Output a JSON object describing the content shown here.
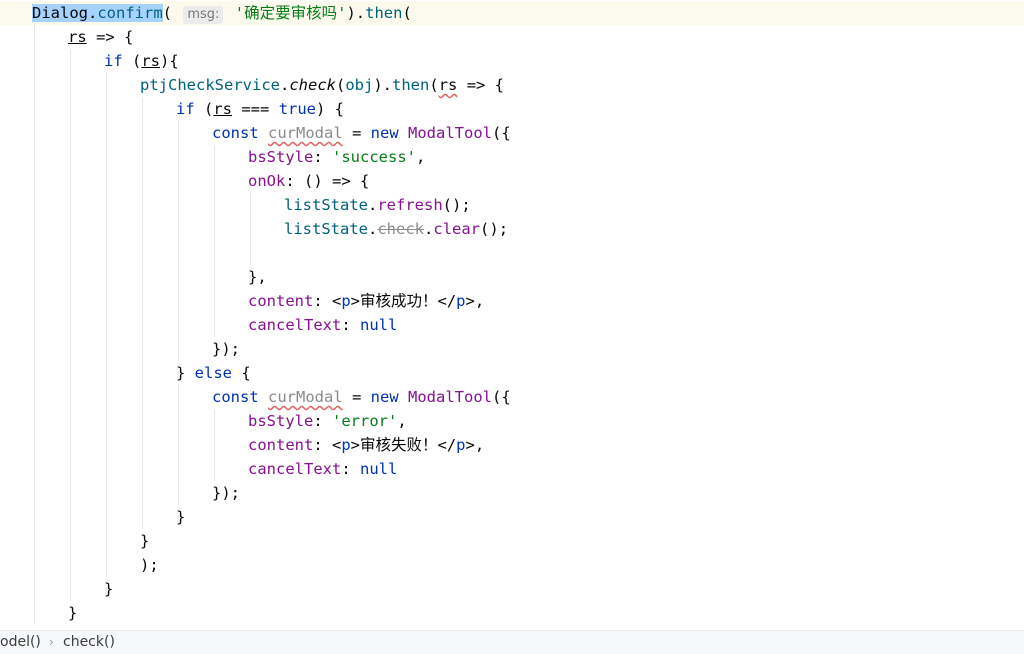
{
  "editor": {
    "lines": [
      {
        "indent": 0,
        "current": true,
        "tokens": [
          {
            "t": "Dialog",
            "c": "sel"
          },
          {
            "t": ".",
            "c": "sel"
          },
          {
            "t": "confirm",
            "c": "sel t-method"
          },
          {
            "t": "( "
          },
          {
            "t": "msg:",
            "c": "hint"
          },
          {
            "t": " "
          },
          {
            "t": "'确定要审核吗'",
            "c": "t-str"
          },
          {
            "t": ")."
          },
          {
            "t": "then",
            "c": "t-then"
          },
          {
            "t": "("
          }
        ]
      },
      {
        "indent": 1,
        "tokens": [
          {
            "t": "rs",
            "c": "t-param"
          },
          {
            "t": " => {"
          }
        ]
      },
      {
        "indent": 2,
        "tokens": [
          {
            "t": "if",
            "c": "t-kw"
          },
          {
            "t": " ("
          },
          {
            "t": "rs",
            "c": "t-param"
          },
          {
            "t": "){"
          }
        ]
      },
      {
        "indent": 3,
        "tokens": [
          {
            "t": "ptjCheckService",
            "c": "t-var"
          },
          {
            "t": "."
          },
          {
            "t": "check",
            "c": "t-check"
          },
          {
            "t": "("
          },
          {
            "t": "obj",
            "c": "t-var"
          },
          {
            "t": ")."
          },
          {
            "t": "then",
            "c": "t-then"
          },
          {
            "t": "("
          },
          {
            "t": "rs",
            "c": "t-param-squiggle"
          },
          {
            "t": " => {"
          }
        ]
      },
      {
        "indent": 4,
        "tokens": [
          {
            "t": "if",
            "c": "t-kw"
          },
          {
            "t": " ("
          },
          {
            "t": "rs",
            "c": "t-param"
          },
          {
            "t": " === "
          },
          {
            "t": "true",
            "c": "t-kw"
          },
          {
            "t": ") {"
          }
        ]
      },
      {
        "indent": 5,
        "tokens": [
          {
            "t": "const",
            "c": "t-kw"
          },
          {
            "t": " "
          },
          {
            "t": "curModal",
            "c": "t-unused"
          },
          {
            "t": " = "
          },
          {
            "t": "new",
            "c": "t-kw"
          },
          {
            "t": " "
          },
          {
            "t": "ModalTool",
            "c": "t-prop"
          },
          {
            "t": "({"
          }
        ]
      },
      {
        "indent": 6,
        "tokens": [
          {
            "t": "bsStyle",
            "c": "t-prop"
          },
          {
            "t": ": "
          },
          {
            "t": "'success'",
            "c": "t-str"
          },
          {
            "t": ","
          }
        ]
      },
      {
        "indent": 6,
        "tokens": [
          {
            "t": "onOk",
            "c": "t-prop"
          },
          {
            "t": ": () => {"
          }
        ]
      },
      {
        "indent": 7,
        "tokens": [
          {
            "t": "listState",
            "c": "t-var"
          },
          {
            "t": "."
          },
          {
            "t": "refresh",
            "c": "t-prop"
          },
          {
            "t": "();"
          }
        ]
      },
      {
        "indent": 7,
        "tokens": [
          {
            "t": "listState",
            "c": "t-var"
          },
          {
            "t": "."
          },
          {
            "t": "check",
            "c": "t-deprecated"
          },
          {
            "t": "."
          },
          {
            "t": "clear",
            "c": "t-prop"
          },
          {
            "t": "();"
          }
        ]
      },
      {
        "indent": 7,
        "tokens": []
      },
      {
        "indent": 6,
        "tokens": [
          {
            "t": "},"
          }
        ]
      },
      {
        "indent": 6,
        "tokens": [
          {
            "t": "content",
            "c": "t-prop"
          },
          {
            "t": ": <"
          },
          {
            "t": "p",
            "c": "t-tag"
          },
          {
            "t": ">审核成功！</"
          },
          {
            "t": "p",
            "c": "t-tag"
          },
          {
            "t": ">,"
          }
        ]
      },
      {
        "indent": 6,
        "tokens": [
          {
            "t": "cancelText",
            "c": "t-prop"
          },
          {
            "t": ": "
          },
          {
            "t": "null",
            "c": "t-null"
          }
        ]
      },
      {
        "indent": 5,
        "tokens": [
          {
            "t": "});"
          }
        ]
      },
      {
        "indent": 4,
        "tokens": [
          {
            "t": "} "
          },
          {
            "t": "else",
            "c": "t-kw"
          },
          {
            "t": " {"
          }
        ]
      },
      {
        "indent": 5,
        "tokens": [
          {
            "t": "const",
            "c": "t-kw"
          },
          {
            "t": " "
          },
          {
            "t": "curModal",
            "c": "t-unused"
          },
          {
            "t": " = "
          },
          {
            "t": "new",
            "c": "t-kw"
          },
          {
            "t": " "
          },
          {
            "t": "ModalTool",
            "c": "t-prop"
          },
          {
            "t": "({"
          }
        ]
      },
      {
        "indent": 6,
        "tokens": [
          {
            "t": "bsStyle",
            "c": "t-prop"
          },
          {
            "t": ": "
          },
          {
            "t": "'error'",
            "c": "t-str"
          },
          {
            "t": ","
          }
        ]
      },
      {
        "indent": 6,
        "tokens": [
          {
            "t": "content",
            "c": "t-prop"
          },
          {
            "t": ": <"
          },
          {
            "t": "p",
            "c": "t-tag"
          },
          {
            "t": ">审核失败！</"
          },
          {
            "t": "p",
            "c": "t-tag"
          },
          {
            "t": ">,"
          }
        ]
      },
      {
        "indent": 6,
        "tokens": [
          {
            "t": "cancelText",
            "c": "t-prop"
          },
          {
            "t": ": "
          },
          {
            "t": "null",
            "c": "t-null"
          }
        ]
      },
      {
        "indent": 5,
        "tokens": [
          {
            "t": "});"
          }
        ]
      },
      {
        "indent": 4,
        "tokens": [
          {
            "t": "}"
          }
        ]
      },
      {
        "indent": 3,
        "tokens": [
          {
            "t": "}"
          }
        ]
      },
      {
        "indent": 3,
        "tokens": [
          {
            "t": ");"
          }
        ]
      },
      {
        "indent": 2,
        "tokens": [
          {
            "t": "}"
          }
        ]
      },
      {
        "indent": 1,
        "tokens": [
          {
            "t": "}"
          }
        ]
      }
    ]
  },
  "statusbar": {
    "breadcrumbs": [
      "odel()",
      "check()"
    ],
    "separator": "›"
  },
  "colors": {
    "keyword": "#0033b3",
    "string": "#067d17",
    "property": "#871094",
    "variable": "#00627a",
    "selection": "#a6d2ff",
    "current_line": "#fcfaed"
  }
}
